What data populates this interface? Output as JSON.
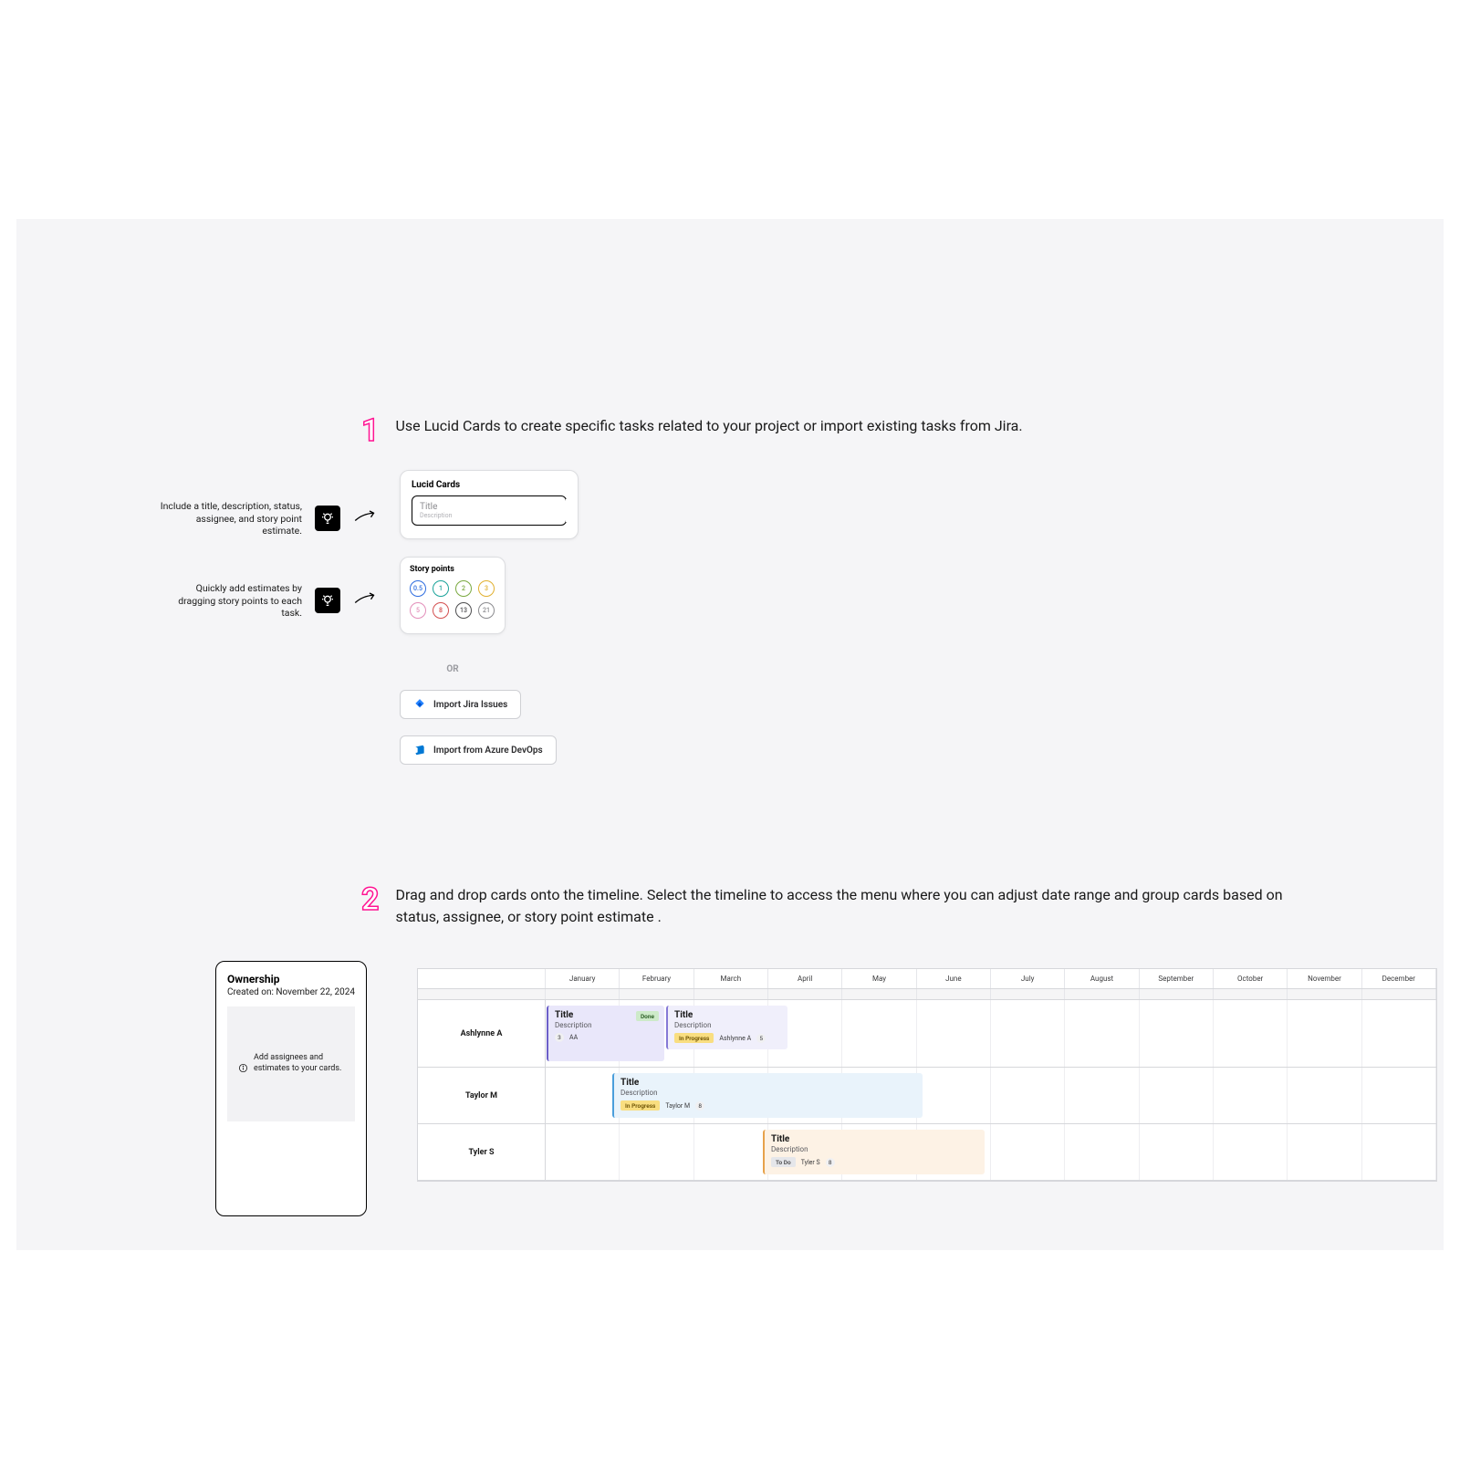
{
  "step1": {
    "number": "1",
    "text": "Use Lucid Cards to create specific tasks related to your project or import existing tasks from Jira."
  },
  "tip1": "Include a title, description, status, assignee, and story point estimate.",
  "tip2": "Quickly add estimates by dragging story points to each task.",
  "lucid_card": {
    "header": "Lucid Cards",
    "title_placeholder": "Title",
    "desc_placeholder": "Description"
  },
  "story_points": {
    "header": "Story points",
    "chips": [
      {
        "label": "0.5",
        "color": "#2d6cdf"
      },
      {
        "label": "1",
        "color": "#1aa39a"
      },
      {
        "label": "2",
        "color": "#7aa93f"
      },
      {
        "label": "3",
        "color": "#e1b030"
      },
      {
        "label": "5",
        "color": "#e38fba"
      },
      {
        "label": "8",
        "color": "#d45050"
      },
      {
        "label": "13",
        "color": "#4d4d4f"
      },
      {
        "label": "21",
        "color": "#8b8b8f"
      }
    ]
  },
  "or_label": "OR",
  "import_jira": "Import Jira Issues",
  "import_azure": "Import from Azure DevOps",
  "step2": {
    "number": "2",
    "text": "Drag and drop cards onto the timeline. Select the timeline to access the menu where you can adjust date range and group cards based on status, assignee, or story point estimate ."
  },
  "ownership": {
    "title": "Ownership",
    "date": "Created on: November 22, 2024",
    "hint": "Add assignees and estimates to your cards."
  },
  "months": [
    "January",
    "February",
    "March",
    "April",
    "May",
    "June",
    "July",
    "August",
    "September",
    "October",
    "November",
    "December"
  ],
  "rows": [
    {
      "name": "Ashlynne A"
    },
    {
      "name": "Taylor M"
    },
    {
      "name": "Tyler S"
    }
  ],
  "tasks": {
    "a1": {
      "title": "Title",
      "desc": "Description",
      "status": "Done",
      "assignee": "AA",
      "sp": "3"
    },
    "a2": {
      "title": "Title",
      "desc": "Description",
      "status": "In Progress",
      "assignee": "Ashlynne A",
      "sp": "5"
    },
    "b1": {
      "title": "Title",
      "desc": "Description",
      "status": "In Progress",
      "assignee": "Taylor M",
      "sp": "8"
    },
    "c1": {
      "title": "Title",
      "desc": "Description",
      "status": "To Do",
      "assignee": "Tyler S",
      "sp": "8"
    }
  }
}
